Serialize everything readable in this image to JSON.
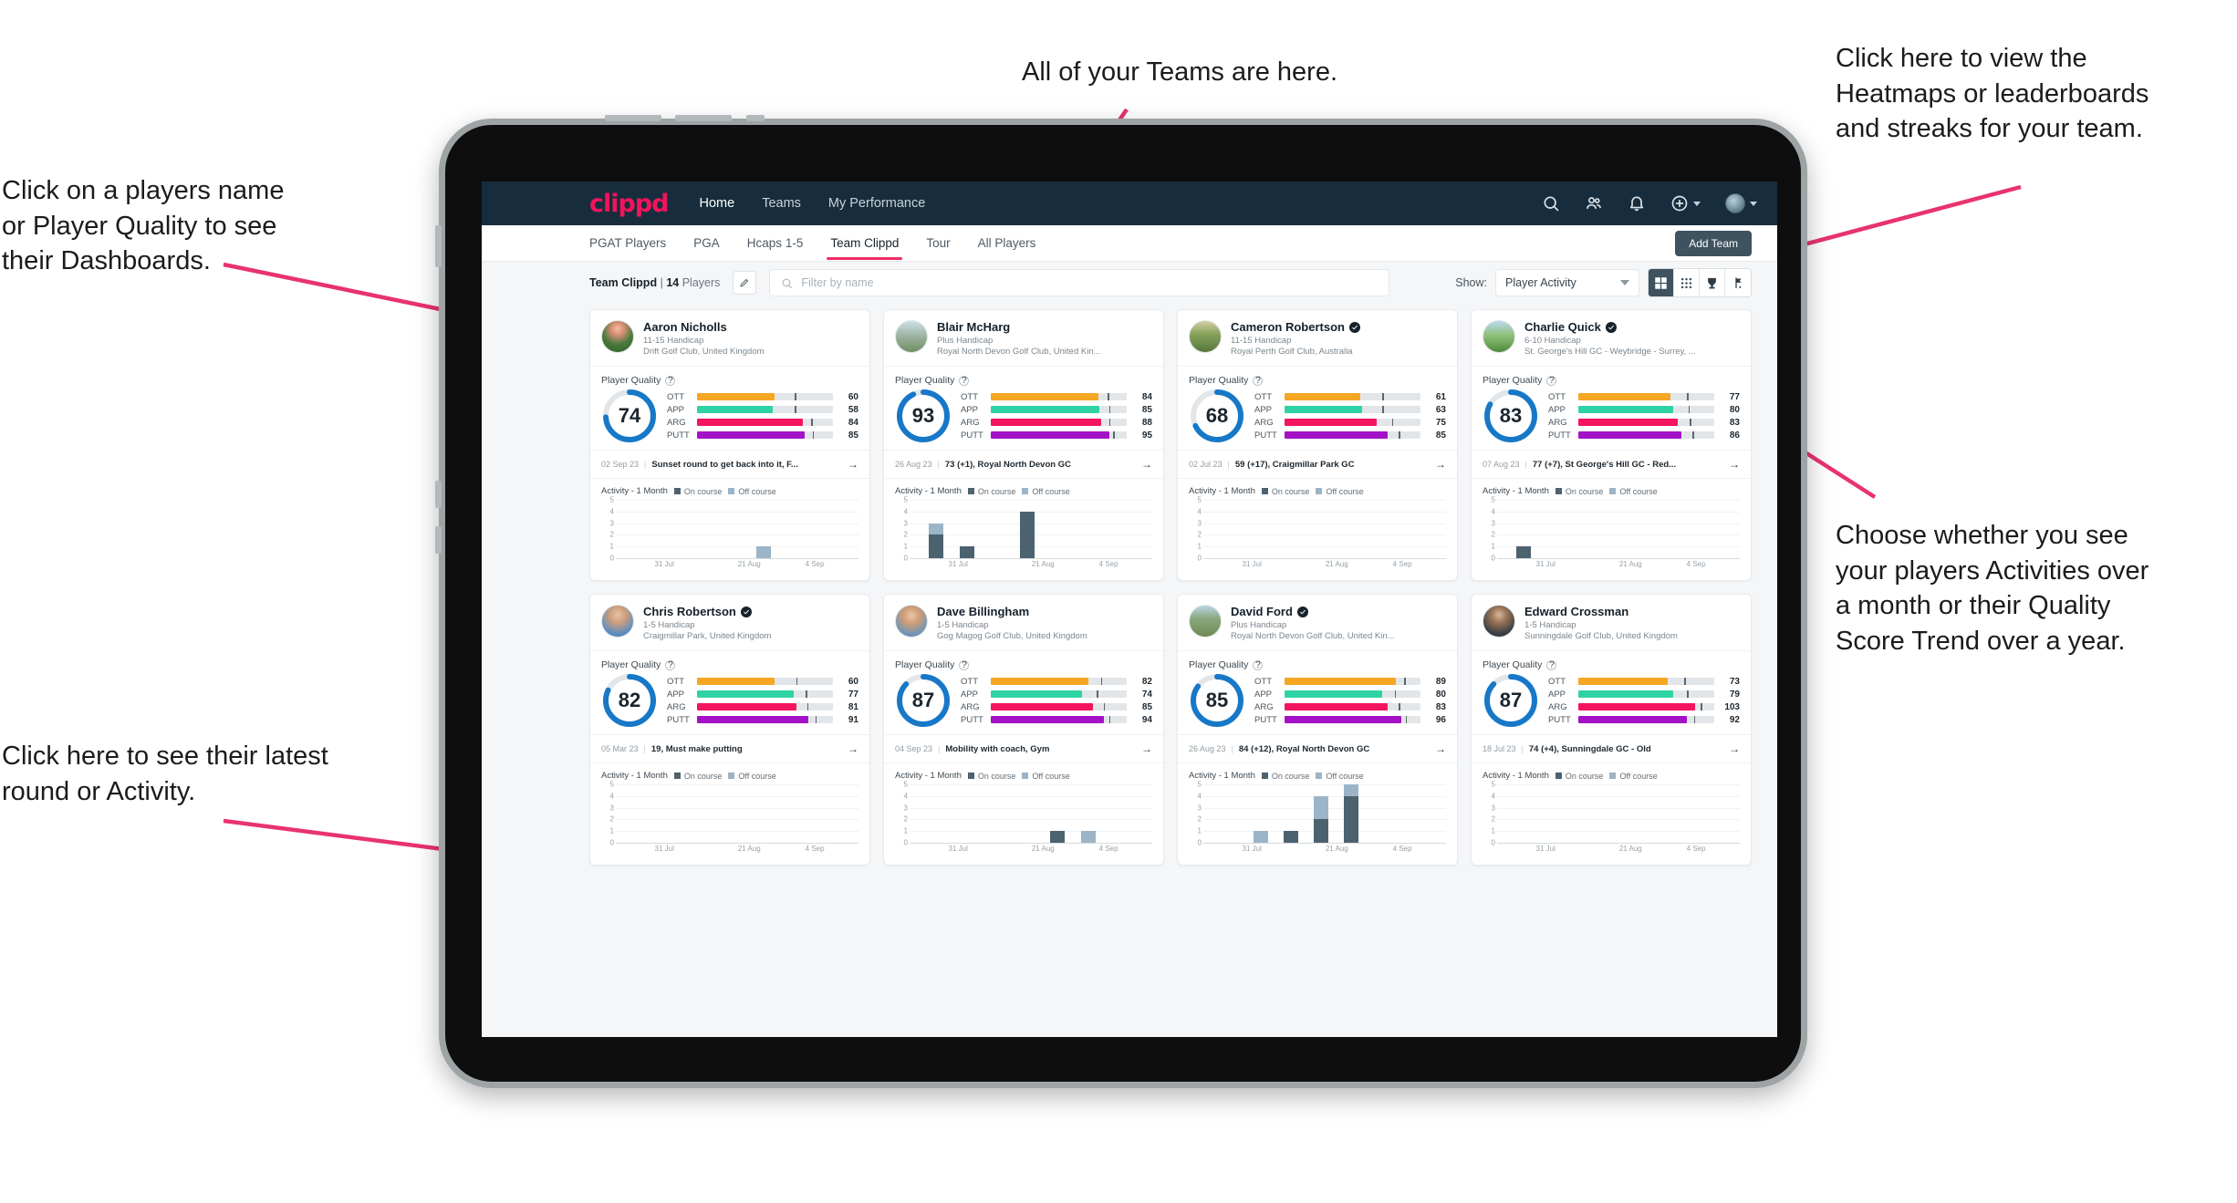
{
  "annotations": {
    "top": "All of your Teams are here.",
    "top_left": "Click on a players name\nor Player Quality to see\ntheir Dashboards.",
    "bottom_left": "Click here to see their latest\nround or Activity.",
    "top_right": "Click here to view the\nHeatmaps or leaderboards\nand streaks for your team.",
    "right_middle": "Choose whether you see\nyour players Activities over\na month or their Quality\nScore Trend over a year.",
    "arrow_color": "#e8336d"
  },
  "topnav": {
    "logo": "clippd",
    "links": [
      {
        "label": "Home",
        "active": true
      },
      {
        "label": "Teams",
        "active": false
      },
      {
        "label": "My Performance",
        "active": false
      }
    ],
    "icons": [
      "search-icon",
      "people-icon",
      "bell-icon",
      "plus-circle-icon",
      "avatar-icon"
    ],
    "background": "#172d3d"
  },
  "tabs": [
    {
      "label": "PGAT Players",
      "active": false
    },
    {
      "label": "PGA",
      "active": false
    },
    {
      "label": "Hcaps 1-5",
      "active": false
    },
    {
      "label": "Team Clippd",
      "active": true
    },
    {
      "label": "Tour",
      "active": false
    },
    {
      "label": "All Players",
      "active": false
    }
  ],
  "add_team_label": "Add Team",
  "toolbar": {
    "team_name": "Team Clippd",
    "separator": "|",
    "player_count": "14",
    "players_word": "Players",
    "edit_icon": "pencil-icon",
    "search_placeholder": "Filter by name",
    "show_label": "Show:",
    "show_value": "Player Activity",
    "view_buttons": [
      {
        "name": "grid-view-icon",
        "active": true
      },
      {
        "name": "dot-grid-view-icon",
        "active": false
      },
      {
        "name": "trophy-view-icon",
        "active": false
      },
      {
        "name": "flag-view-icon",
        "active": false
      }
    ]
  },
  "card_labels": {
    "player_quality": "Player Quality",
    "activity_title": "Activity - 1 Month",
    "legend_on": "On course",
    "legend_off": "Off course",
    "arrow": "→"
  },
  "colors": {
    "ott": "#f5a623",
    "app": "#2fd3a5",
    "arg": "#f5155e",
    "putt": "#a312c6",
    "ring": "#1878c8",
    "on_course": "#4d626f",
    "off_course": "#9cb4c7",
    "accent": "#ef2b63"
  },
  "chart_data": {
    "type": "bar",
    "title": "Activity - 1 Month",
    "xlabel": "",
    "ylabel": "",
    "ylim": [
      0,
      5
    ],
    "yticks": [
      0,
      1,
      2,
      3,
      4,
      5
    ],
    "xticks": [
      "31 Jul",
      "21 Aug",
      "4 Sep"
    ],
    "legend": [
      "On course",
      "Off course"
    ],
    "legend_position": "top",
    "grid": true,
    "stacked": true,
    "panels": [
      {
        "player": "Aaron Nicholls",
        "bars": [
          {
            "slot": 5,
            "on": 0,
            "off": 1
          }
        ]
      },
      {
        "player": "Blair McHarg",
        "bars": [
          {
            "slot": 1,
            "on": 2,
            "off": 1
          },
          {
            "slot": 2,
            "on": 1,
            "off": 0
          },
          {
            "slot": 4,
            "on": 4,
            "off": 0
          }
        ]
      },
      {
        "player": "Cameron Robertson",
        "bars": []
      },
      {
        "player": "Charlie Quick",
        "bars": [
          {
            "slot": 1,
            "on": 1,
            "off": 0
          }
        ]
      },
      {
        "player": "Chris Robertson",
        "bars": []
      },
      {
        "player": "Dave Billingham",
        "bars": [
          {
            "slot": 5,
            "on": 1,
            "off": 0
          },
          {
            "slot": 6,
            "on": 0,
            "off": 1
          }
        ]
      },
      {
        "player": "David Ford",
        "bars": [
          {
            "slot": 2,
            "on": 0,
            "off": 1
          },
          {
            "slot": 3,
            "on": 1,
            "off": 0
          },
          {
            "slot": 4,
            "on": 2,
            "off": 2
          },
          {
            "slot": 5,
            "on": 4,
            "off": 1
          }
        ]
      },
      {
        "player": "Edward Crossman",
        "bars": []
      }
    ]
  },
  "players": [
    {
      "name": "Aaron Nicholls",
      "verified": false,
      "handicap": "11-15 Handicap",
      "club": "Drift Golf Club, United Kingdom",
      "quality": 74,
      "metrics": [
        {
          "label": "OTT",
          "value": 60,
          "fill": 57,
          "tick": 72
        },
        {
          "label": "APP",
          "value": 58,
          "fill": 56,
          "tick": 72
        },
        {
          "label": "ARG",
          "value": 84,
          "fill": 78,
          "tick": 84
        },
        {
          "label": "PUTT",
          "value": 85,
          "fill": 79,
          "tick": 85
        }
      ],
      "round_date": "02 Sep 23",
      "round_text": "Sunset round to get back into it, F...",
      "avatar": "sunset-course"
    },
    {
      "name": "Blair McHarg",
      "verified": false,
      "handicap": "Plus Handicap",
      "club": "Royal North Devon Golf Club, United Kin...",
      "quality": 93,
      "metrics": [
        {
          "label": "OTT",
          "value": 84,
          "fill": 79,
          "tick": 86
        },
        {
          "label": "APP",
          "value": 85,
          "fill": 80,
          "tick": 87
        },
        {
          "label": "ARG",
          "value": 88,
          "fill": 81,
          "tick": 87
        },
        {
          "label": "PUTT",
          "value": 95,
          "fill": 87,
          "tick": 90
        }
      ],
      "round_date": "26 Aug 23",
      "round_text": "73 (+1), Royal North Devon GC",
      "avatar": "links-course"
    },
    {
      "name": "Cameron Robertson",
      "verified": true,
      "handicap": "11-15 Handicap",
      "club": "Royal Perth Golf Club, Australia",
      "quality": 68,
      "metrics": [
        {
          "label": "OTT",
          "value": 61,
          "fill": 56,
          "tick": 72
        },
        {
          "label": "APP",
          "value": 63,
          "fill": 57,
          "tick": 72
        },
        {
          "label": "ARG",
          "value": 75,
          "fill": 68,
          "tick": 79
        },
        {
          "label": "PUTT",
          "value": 85,
          "fill": 76,
          "tick": 84
        }
      ],
      "round_date": "02 Jul 23",
      "round_text": "59 (+17), Craigmillar Park GC",
      "avatar": "tree-course"
    },
    {
      "name": "Charlie Quick",
      "verified": true,
      "handicap": "6-10 Handicap",
      "club": "St. George's Hill GC - Weybridge - Surrey, ...",
      "quality": 83,
      "metrics": [
        {
          "label": "OTT",
          "value": 77,
          "fill": 68,
          "tick": 80
        },
        {
          "label": "APP",
          "value": 80,
          "fill": 70,
          "tick": 81
        },
        {
          "label": "ARG",
          "value": 83,
          "fill": 73,
          "tick": 82
        },
        {
          "label": "PUTT",
          "value": 86,
          "fill": 76,
          "tick": 84
        }
      ],
      "round_date": "07 Aug 23",
      "round_text": "77 (+7), St George's Hill GC - Red...",
      "avatar": "green-course"
    },
    {
      "name": "Chris Robertson",
      "verified": true,
      "handicap": "1-5 Handicap",
      "club": "Craigmillar Park, United Kingdom",
      "quality": 82,
      "metrics": [
        {
          "label": "OTT",
          "value": 60,
          "fill": 57,
          "tick": 73
        },
        {
          "label": "APP",
          "value": 77,
          "fill": 71,
          "tick": 80
        },
        {
          "label": "ARG",
          "value": 81,
          "fill": 73,
          "tick": 81
        },
        {
          "label": "PUTT",
          "value": 91,
          "fill": 82,
          "tick": 87
        }
      ],
      "round_date": "05 Mar 23",
      "round_text": "19, Must make putting",
      "avatar": "person-blue"
    },
    {
      "name": "Dave Billingham",
      "verified": false,
      "handicap": "1-5 Handicap",
      "club": "Gog Magog Golf Club, United Kingdom",
      "quality": 87,
      "metrics": [
        {
          "label": "OTT",
          "value": 82,
          "fill": 72,
          "tick": 81
        },
        {
          "label": "APP",
          "value": 74,
          "fill": 67,
          "tick": 78
        },
        {
          "label": "ARG",
          "value": 85,
          "fill": 75,
          "tick": 83
        },
        {
          "label": "PUTT",
          "value": 94,
          "fill": 83,
          "tick": 87
        }
      ],
      "round_date": "04 Sep 23",
      "round_text": "Mobility with coach, Gym",
      "avatar": "person-beard"
    },
    {
      "name": "David Ford",
      "verified": true,
      "handicap": "Plus Handicap",
      "club": "Royal North Devon Golf Club, United Kin...",
      "quality": 85,
      "metrics": [
        {
          "label": "OTT",
          "value": 89,
          "fill": 82,
          "tick": 88
        },
        {
          "label": "APP",
          "value": 80,
          "fill": 72,
          "tick": 81
        },
        {
          "label": "ARG",
          "value": 83,
          "fill": 76,
          "tick": 84
        },
        {
          "label": "PUTT",
          "value": 96,
          "fill": 86,
          "tick": 89
        }
      ],
      "round_date": "26 Aug 23",
      "round_text": "84 (+12), Royal North Devon GC",
      "avatar": "golfer-field"
    },
    {
      "name": "Edward Crossman",
      "verified": false,
      "handicap": "1-5 Handicap",
      "club": "Sunningdale Golf Club, United Kingdom",
      "quality": 87,
      "metrics": [
        {
          "label": "OTT",
          "value": 73,
          "fill": 66,
          "tick": 78
        },
        {
          "label": "APP",
          "value": 79,
          "fill": 70,
          "tick": 80
        },
        {
          "label": "ARG",
          "value": 103,
          "fill": 86,
          "tick": 90
        },
        {
          "label": "PUTT",
          "value": 92,
          "fill": 80,
          "tick": 85
        }
      ],
      "round_date": "18 Jul 23",
      "round_text": "74 (+4), Sunningdale GC - Old",
      "avatar": "person-dark"
    }
  ]
}
